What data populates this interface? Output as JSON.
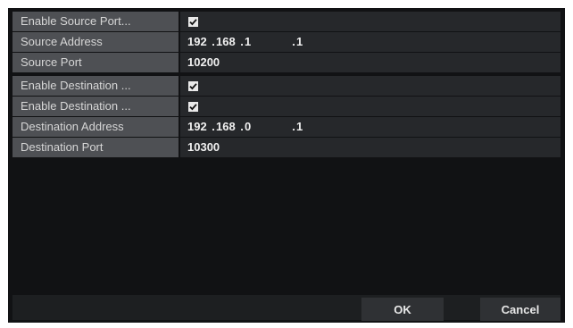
{
  "form": {
    "rows": [
      {
        "label": "Enable Source Port...",
        "type": "checkbox",
        "checked": true
      },
      {
        "label": "Source Address",
        "type": "ip",
        "value": "192 .168 .1 .1",
        "octets": [
          "192",
          "168",
          "1",
          "",
          "1"
        ]
      },
      {
        "label": "Source Port",
        "type": "text",
        "value": "10200"
      },
      {
        "label": "Enable Destination ...",
        "type": "checkbox",
        "checked": true
      },
      {
        "label": "Enable Destination ...",
        "type": "checkbox",
        "checked": true
      },
      {
        "label": "Destination Address",
        "type": "ip",
        "value": "192 .168 .0 .1",
        "octets": [
          "192",
          "168",
          "0",
          "",
          "1"
        ]
      },
      {
        "label": "Destination Port",
        "type": "text",
        "value": "10300"
      }
    ]
  },
  "buttons": {
    "ok_label": "OK",
    "cancel_label": "Cancel"
  },
  "colors": {
    "background": "#111214",
    "label_bg": "#4e5054",
    "row_bg": "#26282b",
    "checkbox": "#e9e9e9"
  },
  "icons": {
    "checkbox": "checkmark-icon"
  }
}
